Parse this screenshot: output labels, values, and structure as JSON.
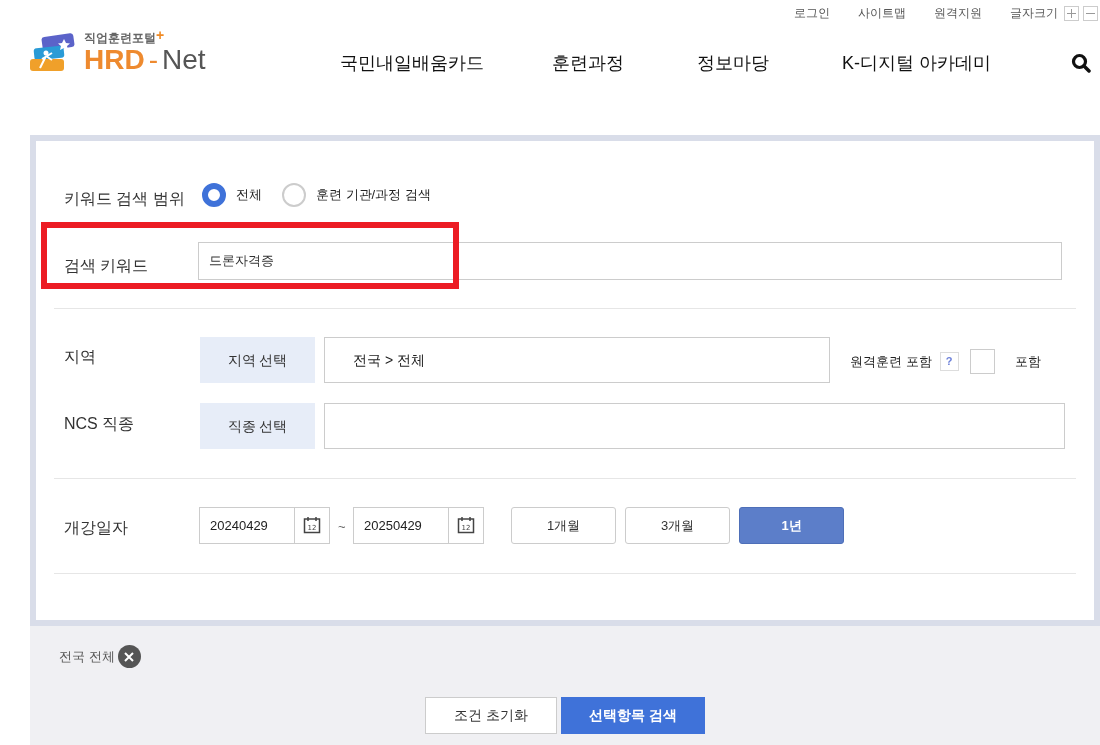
{
  "utility_links": [
    "로그인",
    "사이트맵",
    "원격지원",
    "글자크기"
  ],
  "logo": {
    "tagline": "직업훈련포털",
    "plus": "+",
    "brand_main": "HRD",
    "brand_dash": "-",
    "brand_sub": "Net"
  },
  "nav": [
    "국민내일배움카드",
    "훈련과정",
    "정보마당",
    "K-디지털 아카데미"
  ],
  "keyword_scope": {
    "label": "키워드 검색 범위",
    "options": [
      {
        "label": "전체",
        "selected": true
      },
      {
        "label": "훈련 기관/과정 검색",
        "selected": false
      }
    ]
  },
  "keyword": {
    "label": "검색 키워드",
    "value": "드론자격증",
    "highlighted": true
  },
  "region": {
    "label": "지역",
    "button": "지역 선택",
    "value": "전국 > 전체",
    "remote_label": "원격훈련 포함",
    "help": "?",
    "include_label": "포함",
    "include_checked": false
  },
  "ncs": {
    "label": "NCS 직종",
    "button": "직종 선택"
  },
  "date": {
    "label": "개강일자",
    "from": "20240429",
    "tilde": "~",
    "to": "20250429",
    "calendar_day": [
      "12",
      "12"
    ],
    "periods": [
      {
        "label": "1개월",
        "selected": false
      },
      {
        "label": "3개월",
        "selected": false
      },
      {
        "label": "1년",
        "selected": true
      }
    ]
  },
  "chips": [
    "전국 전체"
  ],
  "actions": [
    "조건 초기화",
    "선택항목 검색"
  ]
}
